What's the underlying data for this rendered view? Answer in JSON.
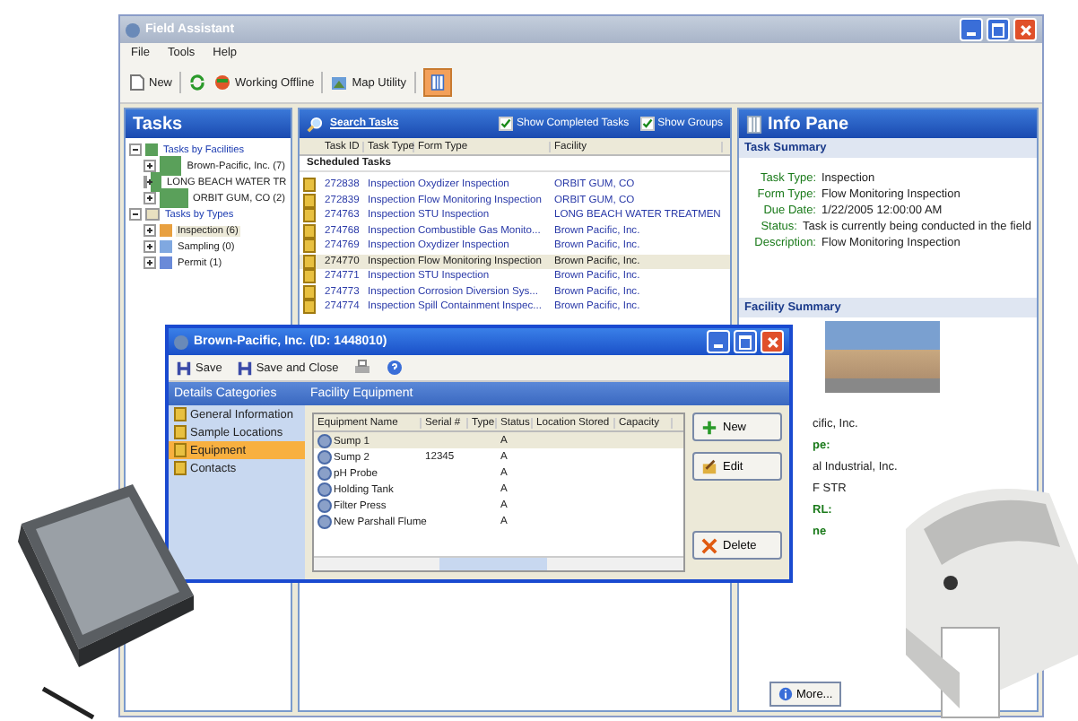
{
  "window": {
    "title": "Field Assistant"
  },
  "menu": [
    "File",
    "Tools",
    "Help"
  ],
  "toolbar": [
    {
      "kind": "new",
      "label": "New"
    },
    {
      "kind": "sync"
    },
    {
      "kind": "offline",
      "label": "Working Offline"
    },
    {
      "kind": "map",
      "label": "Map Utility"
    },
    {
      "kind": "pane",
      "selected": true
    }
  ],
  "tasks_pane": {
    "title": "Tasks",
    "tree": [
      {
        "label": "Tasks by Facilities",
        "kind": "facility-group",
        "expanded": true,
        "selected": false,
        "children": [
          {
            "label": "Brown-Pacific, Inc. (7)",
            "kind": "facility",
            "selected": false
          },
          {
            "label": "LONG BEACH WATER TR",
            "kind": "facility",
            "selected": false
          },
          {
            "label": "ORBIT GUM, CO (2)",
            "kind": "facility",
            "selected": false
          }
        ]
      },
      {
        "label": "Tasks by Types",
        "kind": "type-group",
        "expanded": true,
        "selected": false,
        "children": [
          {
            "label": "Inspection (6)",
            "kind": "inspection",
            "selected": true
          },
          {
            "label": "Sampling (0)",
            "kind": "sampling",
            "selected": false
          },
          {
            "label": "Permit (1)",
            "kind": "permit",
            "selected": false
          }
        ]
      }
    ]
  },
  "task_list": {
    "search_link": "Search Tasks",
    "options": [
      {
        "label": "Show Completed Tasks",
        "checked": true
      },
      {
        "label": "Show Groups",
        "checked": true
      }
    ],
    "columns": [
      "Task ID",
      "Task Type",
      "Form Type",
      "Facility"
    ],
    "group": "Scheduled Tasks",
    "rows": [
      {
        "cells": [
          "272838",
          "Inspection",
          "Oxydizer Inspection",
          "ORBIT GUM, CO"
        ],
        "selected": false
      },
      {
        "cells": [
          "272839",
          "Inspection",
          "Flow Monitoring Inspection",
          "ORBIT GUM, CO"
        ],
        "selected": false
      },
      {
        "cells": [
          "274763",
          "Inspection",
          "STU Inspection",
          "LONG BEACH WATER TREATMEN"
        ],
        "selected": false
      },
      {
        "cells": [
          "274768",
          "Inspection",
          "Combustible Gas Monito...",
          "Brown Pacific, Inc."
        ],
        "selected": false
      },
      {
        "cells": [
          "274769",
          "Inspection",
          "Oxydizer Inspection",
          "Brown Pacific, Inc."
        ],
        "selected": false
      },
      {
        "cells": [
          "274770",
          "Inspection",
          "Flow Monitoring Inspection",
          "Brown Pacific, Inc."
        ],
        "selected": true
      },
      {
        "cells": [
          "274771",
          "Inspection",
          "STU Inspection",
          "Brown Pacific, Inc."
        ],
        "selected": false
      },
      {
        "cells": [
          "274773",
          "Inspection",
          "Corrosion Diversion Sys...",
          "Brown Pacific, Inc."
        ],
        "selected": false
      },
      {
        "cells": [
          "274774",
          "Inspection",
          "Spill Containment Inspec...",
          "Brown Pacific, Inc."
        ],
        "selected": false
      }
    ]
  },
  "info_pane": {
    "title": "Info Pane",
    "task_summary": {
      "title": "Task Summary",
      "fields": [
        {
          "label": "Task Type:",
          "value": "Inspection"
        },
        {
          "label": "Form Type:",
          "value": "Flow Monitoring Inspection"
        },
        {
          "label": "Due Date:",
          "value": "1/22/2005 12:00:00 AM"
        },
        {
          "label": "Status:",
          "value": "Task is currently being conducted in the field"
        },
        {
          "label": "Description:",
          "value": "Flow Monitoring Inspection"
        }
      ]
    },
    "facility_summary": {
      "title": "Facility Summary",
      "fragments": [
        {
          "text": "cific, Inc.",
          "kind": "value"
        },
        {
          "text": "pe:",
          "kind": "label"
        },
        {
          "text": "al Industrial, Inc.",
          "kind": "value"
        },
        {
          "text": "F STR",
          "kind": "value"
        },
        {
          "text": "RL:",
          "kind": "label"
        },
        {
          "text": "ne",
          "kind": "label"
        }
      ]
    },
    "more_button": "More..."
  },
  "dialog": {
    "title": "Brown-Pacific, Inc. (ID: 1448010)",
    "toolbar": [
      {
        "kind": "save",
        "label": "Save"
      },
      {
        "kind": "save",
        "label": "Save and Close"
      },
      {
        "kind": "print"
      },
      {
        "kind": "help"
      }
    ],
    "categories_title": "Details Categories",
    "categories": [
      {
        "label": "General Information",
        "selected": false
      },
      {
        "label": "Sample Locations",
        "selected": false
      },
      {
        "label": "Equipment",
        "selected": true
      },
      {
        "label": "Contacts",
        "selected": false
      }
    ],
    "panel_title": "Facility Equipment",
    "columns": [
      "Equipment Name",
      "Serial #",
      "Type",
      "Status",
      "Location Stored",
      "Capacity"
    ],
    "rows": [
      {
        "cells": [
          "Sump 1",
          "",
          "",
          "A",
          "",
          ""
        ],
        "selected": true
      },
      {
        "cells": [
          "Sump 2",
          "12345",
          "",
          "A",
          "",
          ""
        ],
        "selected": false
      },
      {
        "cells": [
          "pH Probe",
          "",
          "",
          "A",
          "",
          ""
        ],
        "selected": false
      },
      {
        "cells": [
          "Holding Tank",
          "",
          "",
          "A",
          "",
          ""
        ],
        "selected": false
      },
      {
        "cells": [
          "Filter Press",
          "",
          "",
          "A",
          "",
          ""
        ],
        "selected": false
      },
      {
        "cells": [
          "New Parshall Flume",
          "",
          "",
          "A",
          "",
          ""
        ],
        "selected": false
      }
    ],
    "buttons": [
      {
        "kind": "new",
        "label": "New"
      },
      {
        "kind": "edit",
        "label": "Edit"
      },
      {
        "kind": "delete",
        "label": "Delete"
      }
    ]
  }
}
